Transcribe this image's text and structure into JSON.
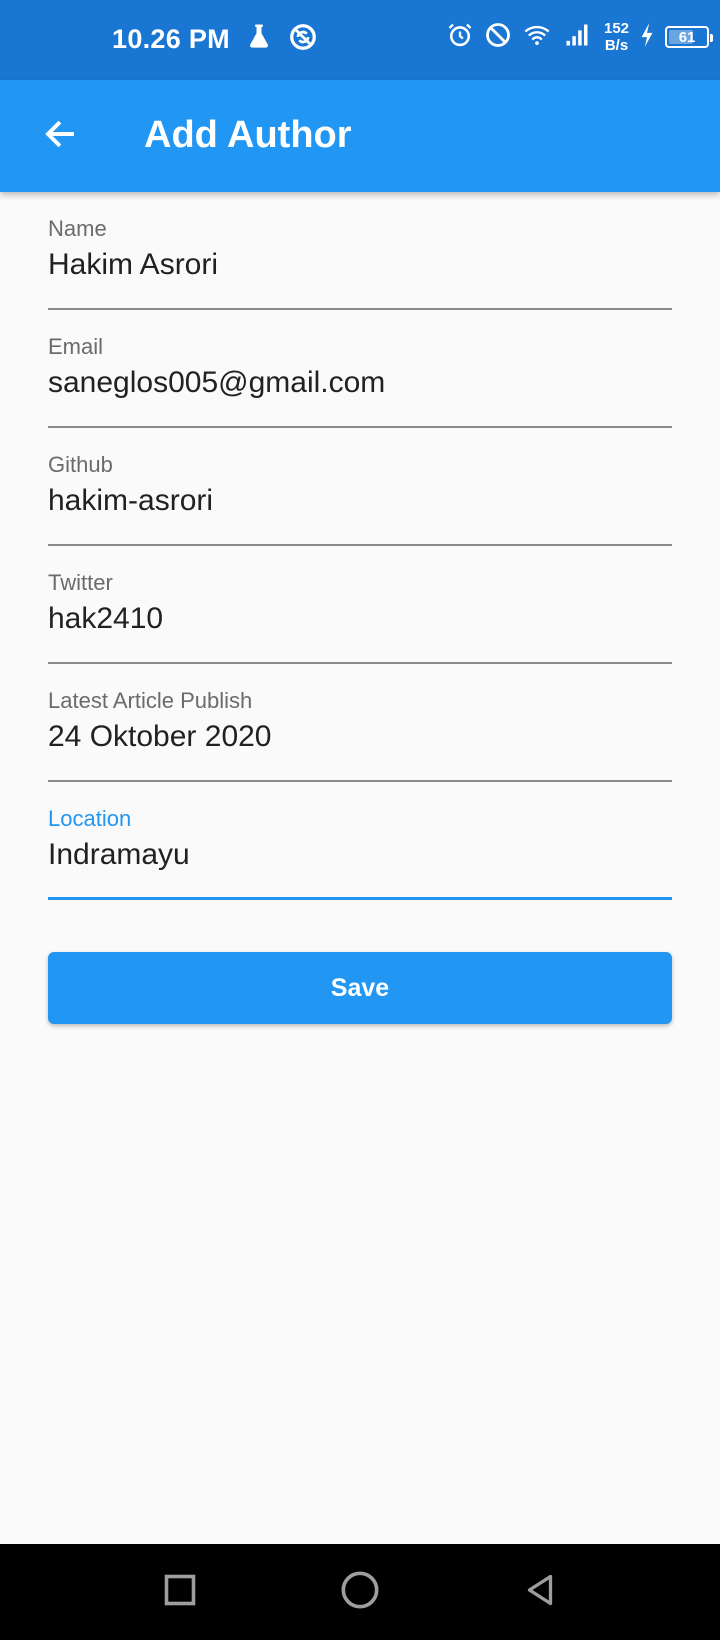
{
  "status_bar": {
    "time": "10.26 PM",
    "net_speed_value": "152",
    "net_speed_unit": "B/s",
    "battery_level": "61",
    "icons": [
      "flask-icon",
      "sync-icon",
      "alarm-icon",
      "do-not-disturb-icon",
      "wifi-icon",
      "signal-icon",
      "charging-icon",
      "battery-icon"
    ]
  },
  "app_bar": {
    "title": "Add Author",
    "back_icon": "arrow-back-icon"
  },
  "form": {
    "fields": [
      {
        "label": "Name",
        "value": "Hakim Asrori"
      },
      {
        "label": "Email",
        "value": "saneglos005@gmail.com"
      },
      {
        "label": "Github",
        "value": "hakim-asrori"
      },
      {
        "label": "Twitter",
        "value": "hak2410"
      },
      {
        "label": "Latest Article Publish",
        "value": "24 Oktober 2020"
      },
      {
        "label": "Location",
        "value": "Indramayu",
        "focused": true
      }
    ],
    "save_label": "Save"
  },
  "colors": {
    "status_bar": "#1976d2",
    "app_bar": "#2196f3",
    "accent": "#2196f3",
    "background": "#fafafa"
  },
  "nav_bar": {
    "icons": [
      "recents-square-icon",
      "home-circle-icon",
      "back-triangle-icon"
    ]
  }
}
